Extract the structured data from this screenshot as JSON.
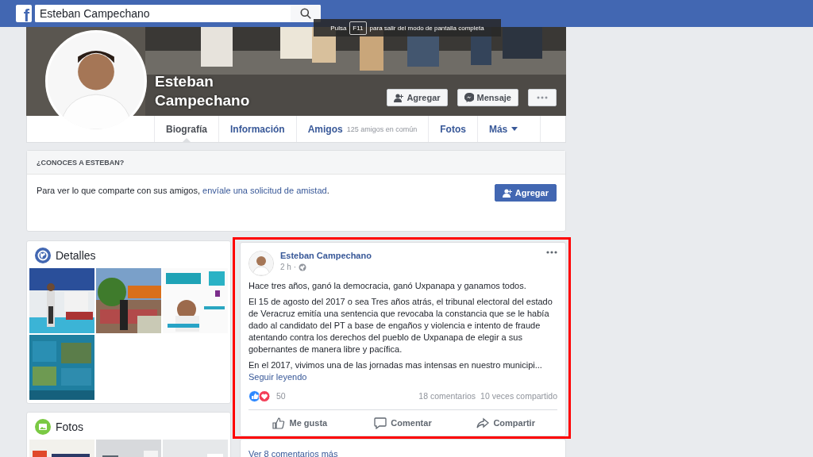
{
  "top_bar": {
    "logo": "f",
    "search": {
      "value": "Esteban Campechano"
    }
  },
  "fullscreen_hint": {
    "prefix": "Pulsa",
    "key": "F11",
    "suffix": "para salir del modo de pantalla completa"
  },
  "profile": {
    "name": "Esteban Campechano",
    "buttons": [
      {
        "kind": "add-friend",
        "label": "Agregar"
      },
      {
        "kind": "message",
        "label": "Mensaje"
      },
      {
        "kind": "more"
      }
    ]
  },
  "tabs": [
    {
      "label": "Biografía",
      "selected": true
    },
    {
      "label": "Información",
      "selected": false
    },
    {
      "label": "Amigos",
      "note": "125 amigos en común",
      "selected": false
    },
    {
      "label": "Fotos",
      "selected": false
    },
    {
      "label": "Más",
      "dropdown": true,
      "selected": false
    }
  ],
  "know_card": {
    "title": "¿CONOCES A ESTEBAN?",
    "text": "Para ver lo que comparte con sus amigos, ",
    "link": "envíale una solicitud de amistad",
    "after": ".",
    "button": "Agregar"
  },
  "details": {
    "title": "Detalles"
  },
  "photos_card": {
    "title": "Fotos"
  },
  "post": {
    "highlighted": true,
    "author": "Esteban Campechano",
    "time": "2 h ·",
    "paragraphs": [
      "Hace tres años, ganó la democracia, ganó Uxpanapa y ganamos todos.",
      "El 15 de agosto del 2017 o sea Tres años atrás, el tribunal electoral del estado de Veracruz emitía una sentencia que revocaba la constancia que se le había dado al candidato del PT a base de engaños y violencia e intento de fraude atentando contra los derechos del pueblo de Uxpanapa de elegir a sus gobernantes de manera libre y pacífica.",
      "En el 2017, vivimos una de las jornadas mas intensas en nuestro municipi..."
    ],
    "more_link": "Seguir leyendo",
    "reactions_count": "50",
    "comments": "18 comentarios",
    "shares": "10 veces compartido",
    "actions": [
      {
        "kind": "like",
        "label": "Me gusta"
      },
      {
        "kind": "comment",
        "label": "Comentar"
      },
      {
        "kind": "share",
        "label": "Compartir"
      }
    ]
  },
  "comments_link": "Ver 8 comentarios más"
}
